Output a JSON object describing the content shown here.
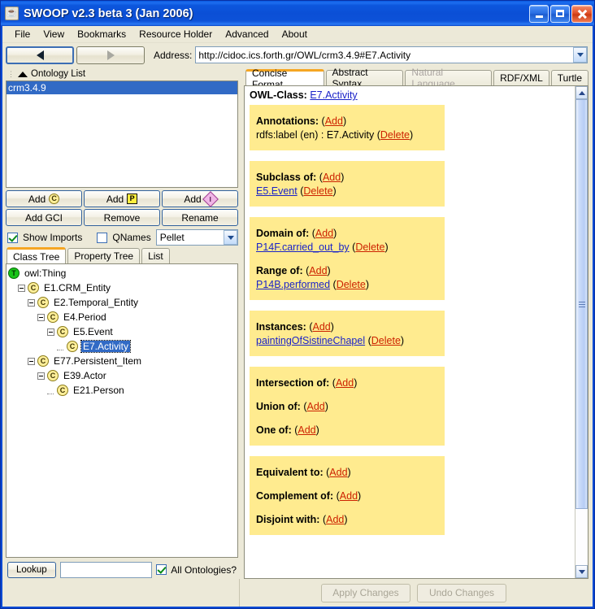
{
  "window": {
    "title": "SWOOP v2.3 beta 3 (Jan 2006)",
    "app_icon": "java-cup-icon",
    "minimize_label": "Minimize",
    "maximize_label": "Maximize",
    "close_label": "Close"
  },
  "menubar": {
    "items": [
      {
        "label": "File"
      },
      {
        "label": "View"
      },
      {
        "label": "Bookmarks"
      },
      {
        "label": "Resource Holder"
      },
      {
        "label": "Advanced"
      },
      {
        "label": "About"
      }
    ]
  },
  "toolbar": {
    "back_label": "Back",
    "forward_label": "Forward",
    "address_label": "Address:",
    "address_value": "http://cidoc.ics.forth.gr/OWL/crm3.4.9#E7.Activity"
  },
  "left_pane": {
    "header": "Ontology List",
    "ontologies": [
      {
        "label": "crm3.4.9",
        "selected": true
      }
    ],
    "buttons": [
      {
        "label": "Add",
        "icon": "class-icon",
        "glyph": "C"
      },
      {
        "label": "Add",
        "icon": "property-icon",
        "glyph": "P"
      },
      {
        "label": "Add",
        "icon": "individual-icon",
        "glyph": "I"
      },
      {
        "label": "Add GCI",
        "icon": null,
        "glyph": null
      },
      {
        "label": "Remove",
        "icon": null,
        "glyph": null
      },
      {
        "label": "Rename",
        "icon": null,
        "glyph": null
      }
    ],
    "options": {
      "show_imports_label": "Show Imports",
      "show_imports_checked": true,
      "qnames_label": "QNames",
      "qnames_checked": false,
      "reasoner_value": "Pellet"
    },
    "tabs": [
      {
        "label": "Class Tree",
        "active": true
      },
      {
        "label": "Property Tree",
        "active": false
      },
      {
        "label": "List",
        "active": false
      }
    ],
    "tree": [
      {
        "label": "owl:Thing",
        "depth": 0,
        "icon": "thing-icon",
        "glyph": "T",
        "expander": false,
        "selected": false
      },
      {
        "label": "E1.CRM_Entity",
        "depth": 1,
        "icon": "class-icon",
        "glyph": "C",
        "expander": true,
        "selected": false
      },
      {
        "label": "E2.Temporal_Entity",
        "depth": 2,
        "icon": "class-icon",
        "glyph": "C",
        "expander": true,
        "selected": false
      },
      {
        "label": "E4.Period",
        "depth": 3,
        "icon": "class-icon",
        "glyph": "C",
        "expander": true,
        "selected": false
      },
      {
        "label": "E5.Event",
        "depth": 4,
        "icon": "class-icon",
        "glyph": "C",
        "expander": true,
        "selected": false
      },
      {
        "label": "E7.Activity",
        "depth": 5,
        "icon": "class-icon",
        "glyph": "C",
        "expander": false,
        "selected": true
      },
      {
        "label": "E77.Persistent_Item",
        "depth": 2,
        "icon": "class-icon",
        "glyph": "C",
        "expander": true,
        "selected": false
      },
      {
        "label": "E39.Actor",
        "depth": 3,
        "icon": "class-icon",
        "glyph": "C",
        "expander": true,
        "selected": false
      },
      {
        "label": "E21.Person",
        "depth": 4,
        "icon": "class-icon",
        "glyph": "C",
        "expander": false,
        "selected": false
      }
    ],
    "lookup": {
      "button_label": "Lookup",
      "input_value": "",
      "all_ontologies_label": "All Ontologies?",
      "all_ontologies_checked": true
    }
  },
  "right_pane": {
    "tabs": [
      {
        "label": "Concise Format",
        "active": true,
        "disabled": false
      },
      {
        "label": "Abstract Syntax",
        "active": false,
        "disabled": false
      },
      {
        "label": "Natural Language",
        "active": false,
        "disabled": true
      },
      {
        "label": "RDF/XML",
        "active": false,
        "disabled": false
      },
      {
        "label": "Turtle",
        "active": false,
        "disabled": false
      }
    ],
    "heading_label": "OWL-Class:",
    "heading_value": "E7.Activity",
    "add_label": "Add",
    "delete_label": "Delete",
    "sections": [
      {
        "rows": [
          {
            "title": "Annotations:",
            "add": true,
            "value": "",
            "value_kind": "none"
          },
          {
            "title": "",
            "add": false,
            "value": "rdfs:label (en) : E7.Activity",
            "value_kind": "plain",
            "delete": true
          }
        ]
      },
      {
        "rows": [
          {
            "title": "Subclass of:",
            "add": true,
            "value": "",
            "value_kind": "none"
          },
          {
            "title": "",
            "add": false,
            "value": "E5.Event",
            "value_kind": "link",
            "delete": true
          }
        ]
      },
      {
        "rows": [
          {
            "title": "Domain of:",
            "add": true,
            "value": "",
            "value_kind": "none"
          },
          {
            "title": "",
            "add": false,
            "value": "P14F.carried_out_by",
            "value_kind": "link",
            "delete": true
          },
          {
            "title": "Range of:",
            "add": true,
            "value": "",
            "value_kind": "none",
            "gap": true
          },
          {
            "title": "",
            "add": false,
            "value": "P14B.performed",
            "value_kind": "link",
            "delete": true
          }
        ]
      },
      {
        "rows": [
          {
            "title": "Instances:",
            "add": true,
            "value": "",
            "value_kind": "none"
          },
          {
            "title": "",
            "add": false,
            "value": "paintingOfSistineChapel",
            "value_kind": "link",
            "delete": true
          }
        ]
      },
      {
        "rows": [
          {
            "title": "Intersection of:",
            "add": true,
            "value": "",
            "value_kind": "none"
          },
          {
            "title": "Union of:",
            "add": true,
            "value": "",
            "value_kind": "none",
            "gap": true
          },
          {
            "title": "One of:",
            "add": true,
            "value": "",
            "value_kind": "none",
            "gap": true
          }
        ]
      },
      {
        "rows": [
          {
            "title": "Equivalent to:",
            "add": true,
            "value": "",
            "value_kind": "none"
          },
          {
            "title": "Complement of:",
            "add": true,
            "value": "",
            "value_kind": "none",
            "gap": true
          },
          {
            "title": "Disjoint with:",
            "add": true,
            "value": "",
            "value_kind": "none",
            "gap": true
          }
        ]
      }
    ]
  },
  "bottombar": {
    "apply_label": "Apply Changes",
    "undo_label": "Undo Changes"
  },
  "colors": {
    "title_blue": "#0a4ad4",
    "section_yellow": "#ffeb8f",
    "link_blue": "#1a23c8",
    "link_red": "#cc2200",
    "selection_blue": "#316ac5",
    "tab_accent_orange": "#f5a623",
    "face": "#ece9d8"
  }
}
